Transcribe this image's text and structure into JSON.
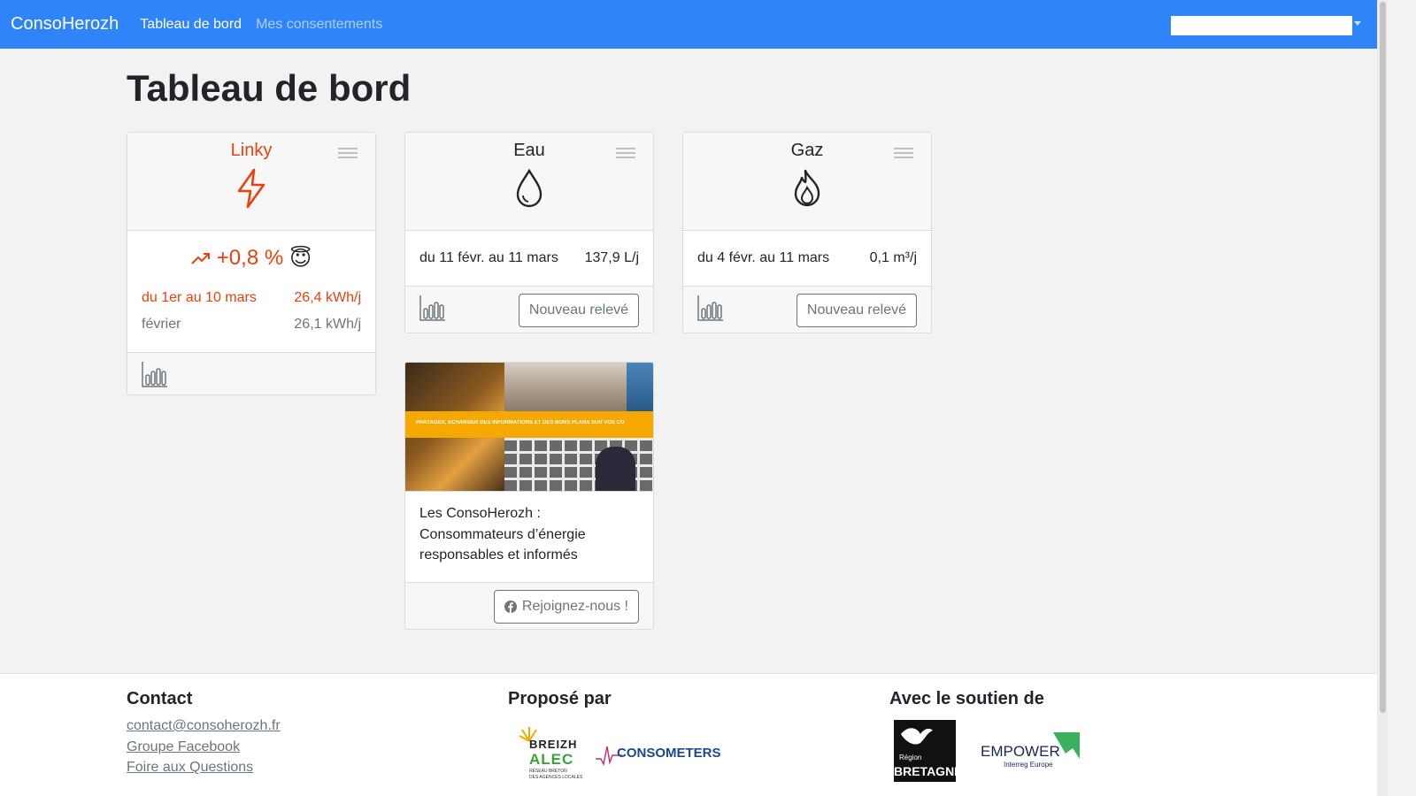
{
  "nav": {
    "brand": "ConsoHerozh",
    "links": [
      "Tableau de bord",
      "Mes consentements"
    ]
  },
  "page": {
    "title": "Tableau de bord"
  },
  "colors": {
    "primary": "#2f84f7",
    "accent": "#e8420e"
  },
  "cards": {
    "linky": {
      "title": "Linky",
      "icon": "lightning-icon",
      "trend": "+0,8 %",
      "trend_emoji": "😇",
      "rows": [
        {
          "label": "du 1er au 10 mars",
          "value": "26,4 kWh/j"
        },
        {
          "label": "février",
          "value": "26,1 kWh/j"
        }
      ]
    },
    "eau": {
      "title": "Eau",
      "icon": "water-drop-icon",
      "period": "du 11 févr. au 11 mars",
      "value": "137,9 L/j",
      "button": "Nouveau relevé"
    },
    "gaz": {
      "title": "Gaz",
      "icon": "flame-icon",
      "period": "du 4 févr. au 11 mars",
      "value": "0,1 m³/j",
      "button": "Nouveau relevé"
    },
    "promo": {
      "banner": "PARTAGER, ECHANGER DES INFORMATIONS ET DES BONS PLANS SUR VOS CO",
      "text": "Les ConsoHerozh : Consommateurs d’énergie responsables et informés",
      "button": "Rejoignez-nous !"
    }
  },
  "footer": {
    "contact": {
      "title": "Contact",
      "links": [
        "contact@consoherozh.fr",
        "Groupe Facebook",
        "Foire aux Questions"
      ]
    },
    "propose": {
      "title": "Proposé par",
      "logo1_lines": [
        "BREIZH",
        "ALEC",
        "RÉSEAU BRETON",
        "DES AGENCES LOCALES"
      ],
      "logo2": "CONSOMETERS"
    },
    "soutien": {
      "title": "Avec le soutien de",
      "logo1_lines": [
        "Région",
        "BRETAGNE"
      ],
      "logo2_lines": [
        "EMPOWER",
        "Interreg Europe"
      ]
    }
  }
}
